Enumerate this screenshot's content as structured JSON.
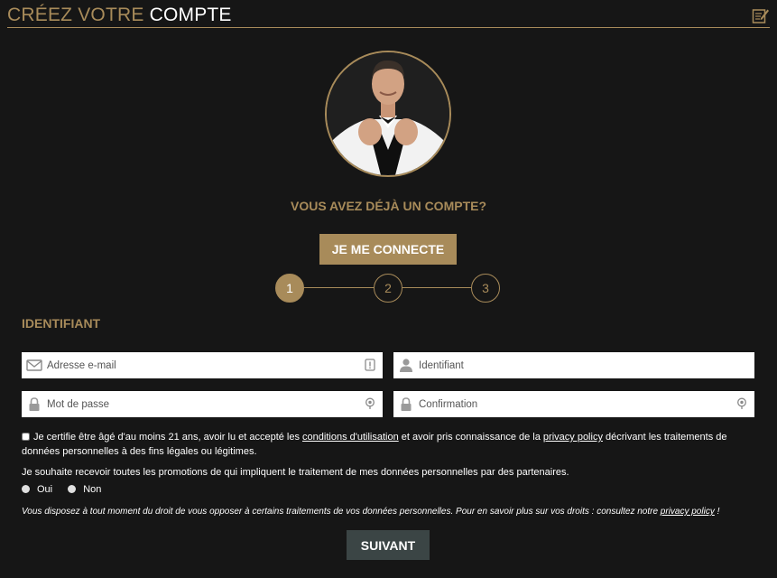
{
  "header": {
    "title_part1": "CRÉEZ VOTRE",
    "title_part2": "COMPTE",
    "edit_icon": "edit-note-icon"
  },
  "account_prompt": {
    "question": "VOUS AVEZ DÉJÀ UN COMPTE?",
    "login_label": "JE ME CONNECTE"
  },
  "steps": [
    "1",
    "2",
    "3"
  ],
  "active_step": 1,
  "section": {
    "title": "IDENTIFIANT"
  },
  "fields": {
    "email": {
      "placeholder": "Adresse e-mail",
      "icon": "envelope-icon"
    },
    "username": {
      "placeholder": "Identifiant",
      "icon": "user-icon"
    },
    "password": {
      "placeholder": "Mot de passe",
      "icon": "lock-icon"
    },
    "confirm": {
      "placeholder": "Confirmation",
      "icon": "lock-icon"
    }
  },
  "consent": {
    "text_before": "Je certifie être âgé d'au moins 21 ans, avoir lu et accepté les ",
    "link_conditions": "conditions d'utilisation",
    "text_middle": " et avoir pris connaissance de la ",
    "link_privacy": "privacy policy",
    "text_after": " décrivant les traitements de données personnelles à des fins légales ou légitimes.",
    "checked": false
  },
  "promotions": {
    "text": "Je souhaite recevoir toutes les promotions de qui impliquent le traitement de mes données personnelles par des partenaires.",
    "options": [
      "Oui",
      "Non"
    ]
  },
  "legal": {
    "text": "Vous disposez à tout moment du droit de vous opposer à certains traitements de vos données personnelles. Pour en savoir plus sur vos droits : consultez notre ",
    "link": "privacy policy",
    "suffix": " !"
  },
  "next_label": "SUIVANT",
  "colors": {
    "background": "#161616",
    "accent": "#a88b5a",
    "next_button": "#3b4545"
  }
}
